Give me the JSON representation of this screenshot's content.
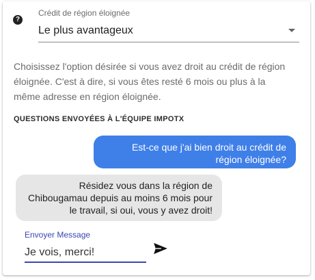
{
  "select": {
    "label": "Crédit de région éloignée",
    "value": "Le plus avantageux",
    "icon": "question-circle-icon"
  },
  "description": "Choisissez l'option désirée si vous avez droit au crédit de région éloignée. C'est à dire, si vous êtes resté 6 mois ou plus à la même adresse en région éloignée.",
  "chat": {
    "section_title": "QUESTIONS ENVOYÉES À L'ÉQUIPE IMPOTX",
    "messages": [
      {
        "from": "user",
        "text": "Est-ce que j'ai bien droit au crédit de région éloignée?"
      },
      {
        "from": "team",
        "text": "Résidez vous dans la région de Chibougamau depuis au moins 6 mois pour le travail, si oui, vous y avez droit!"
      }
    ],
    "input_label": "Envoyer Message",
    "input_value": "Je vois, merci!",
    "send_icon": "send-icon"
  },
  "colors": {
    "user_bubble": "#3f7fe8",
    "team_bubble": "#e6e6e6",
    "accent": "#3a46b0"
  }
}
